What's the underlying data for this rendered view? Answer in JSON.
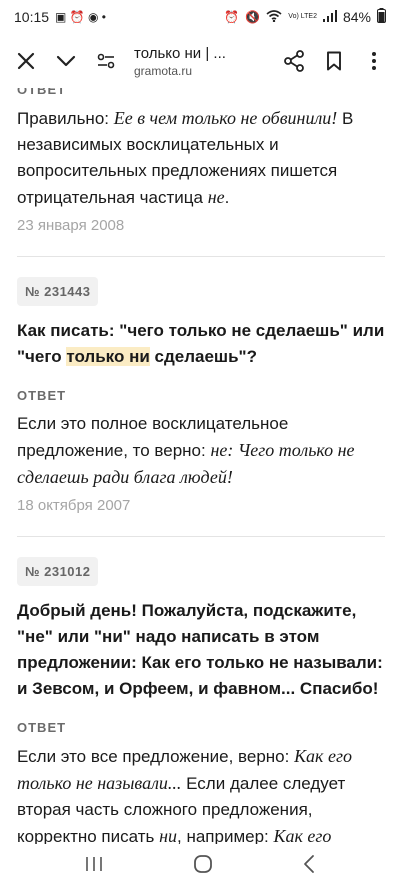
{
  "status": {
    "time": "10:15",
    "battery": "84%",
    "net": "Vo) LTE2"
  },
  "toolbar": {
    "title": "только ни | ...",
    "domain": "gramota.ru"
  },
  "items": [
    {
      "label": "ОТВЕТ",
      "answer_parts": [
        "Правильно: ",
        "Ее в чем только не обвинили!",
        " В независимых восклицательных и вопросительных предложениях пишется отрицательная частица ",
        "не",
        "."
      ],
      "date": "23 января 2008"
    },
    {
      "number": "№ 231443",
      "question_parts": [
        "Как писать: \"чего только не сделаешь\" или \"чего ",
        "только ни",
        " сделаешь\"?"
      ],
      "label": "ОТВЕТ",
      "answer_parts": [
        "Если это полное восклицательное предложение, то верно: ",
        "не: Чего только не сделаешь ради блага людей!"
      ],
      "date": "18 октября 2007"
    },
    {
      "number": "№ 231012",
      "question": "Добрый день! Пожалуйста, подскажите, \"не\" или \"ни\" надо написать в этом предложении: Как его только не называли: и Зевсом, и Орфеем, и фавном... Спасибо!",
      "label": "ОТВЕТ",
      "answer_parts": [
        "Если это все предложение, верно: ",
        "Как его только не называли...",
        " Если далее следует вторая часть сложного предложения, корректно писать ",
        "ни",
        ", например: ",
        "Как его"
      ]
    }
  ]
}
